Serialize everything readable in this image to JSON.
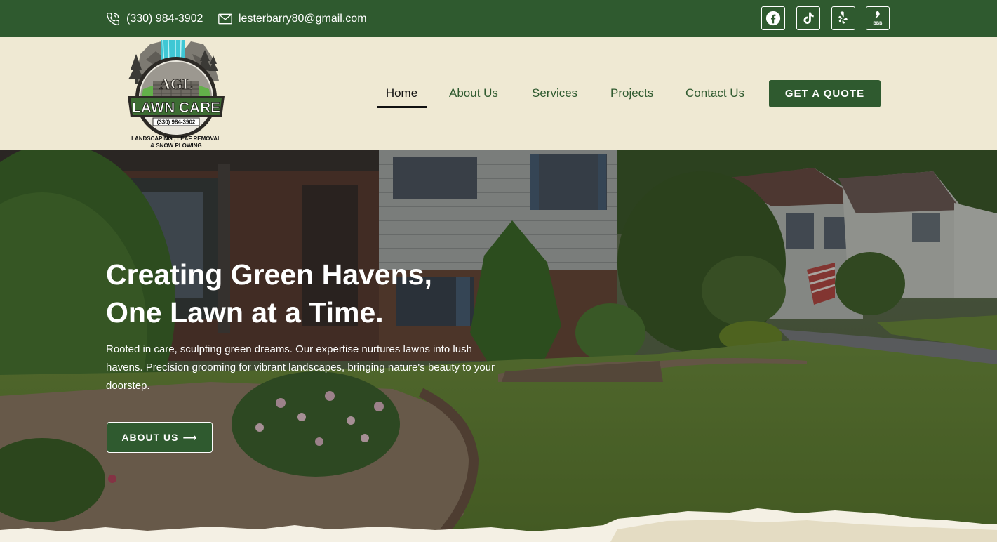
{
  "topbar": {
    "phone": "(330) 984-3902",
    "email": "lesterbarry80@gmail.com",
    "phone_icon": "phone-icon",
    "email_icon": "envelope-icon",
    "social": [
      {
        "name": "facebook-icon"
      },
      {
        "name": "tiktok-icon"
      },
      {
        "name": "yelp-icon"
      },
      {
        "name": "bbb-icon",
        "text": "BBB"
      }
    ]
  },
  "logo": {
    "top_text": "AGL",
    "main_text": "LAWN CARE",
    "phone": "(330) 984-3902",
    "tagline_1": "LANDSCAPING , LEAF REMOVAL",
    "tagline_2": "& SNOW PLOWING"
  },
  "nav": {
    "items": [
      {
        "label": "Home",
        "active": true
      },
      {
        "label": "About Us"
      },
      {
        "label": "Services"
      },
      {
        "label": "Projects"
      },
      {
        "label": "Contact Us"
      }
    ],
    "cta": "GET A QUOTE"
  },
  "hero": {
    "title_1": "Creating Green Havens,",
    "title_2": "One Lawn at a Time.",
    "text": "Rooted in care, sculpting green dreams. Our expertise nurtures lawns into lush havens. Precision grooming for vibrant landscapes, bringing nature's beauty to your doorstep.",
    "button": "ABOUT US",
    "button_arrow": "⟶"
  },
  "colors": {
    "brand_green": "#2f5a2f",
    "cream": "#efe9d3",
    "white": "#ffffff"
  }
}
